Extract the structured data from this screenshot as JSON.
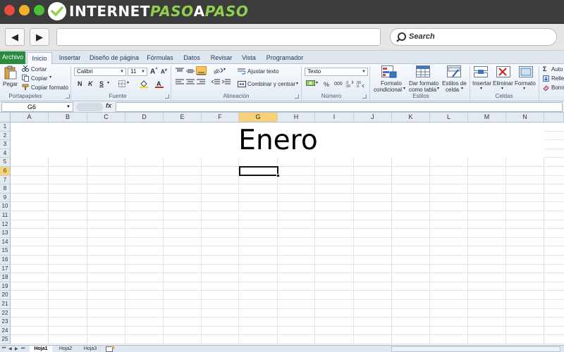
{
  "brand": {
    "part1": "INTERNET",
    "part2": "PASO",
    "part3": "A",
    "part4": "PASO"
  },
  "browser": {
    "back_label": "◀",
    "forward_label": "▶",
    "url_value": "",
    "search_placeholder": "Search"
  },
  "ribbon_tabs": [
    "Archivo",
    "Inicio",
    "Insertar",
    "Diseño de página",
    "Fórmulas",
    "Datos",
    "Revisar",
    "Vista",
    "Programador"
  ],
  "active_tab": "Inicio",
  "ribbon": {
    "clipboard": {
      "paste": "Pegar",
      "cut": "Cortar",
      "copy": "Copiar",
      "format_painter": "Copiar formato",
      "group": "Portapapeles"
    },
    "font": {
      "name": "Calibri",
      "size": "11",
      "bold": "N",
      "italic": "K",
      "underline": "S",
      "group": "Fuente"
    },
    "alignment": {
      "wrap": "Ajustar texto",
      "merge": "Combinar y centrar",
      "group": "Alineación"
    },
    "number": {
      "format": "Texto",
      "percent": "%",
      "thousands": "000",
      "group": "Número"
    },
    "styles": {
      "conditional_l1": "Formato",
      "conditional_l2": "condicional",
      "table_l1": "Dar formato",
      "table_l2": "como tabla",
      "cell_l1": "Estilos de",
      "cell_l2": "celda",
      "group": "Estilos"
    },
    "cells": {
      "insert": "Insertar",
      "delete": "Eliminar",
      "format": "Formato",
      "group": "Celdas"
    },
    "editing": {
      "autosum": "Auto",
      "fill": "Relle",
      "clear": "Borra"
    }
  },
  "name_box": "G6",
  "fx_label": "fx",
  "columns": [
    "A",
    "B",
    "C",
    "D",
    "E",
    "F",
    "G",
    "H",
    "I",
    "J",
    "K",
    "L",
    "M",
    "N"
  ],
  "rows": [
    "1",
    "2",
    "3",
    "4",
    "5",
    "6",
    "7",
    "8",
    "9",
    "10",
    "11",
    "12",
    "13",
    "14",
    "15",
    "16",
    "17",
    "18",
    "19",
    "20",
    "21",
    "22",
    "23",
    "24",
    "25"
  ],
  "selected_column": "G",
  "selected_row": "6",
  "merged_title": "Enero",
  "sheets": [
    "Hoja1",
    "Hoja2",
    "Hoja3"
  ],
  "active_sheet": "Hoja1",
  "colors": {
    "file_tab": "#2a8a3e",
    "selection_header": "#f7d27a",
    "brand_accent": "#8fd14f"
  }
}
